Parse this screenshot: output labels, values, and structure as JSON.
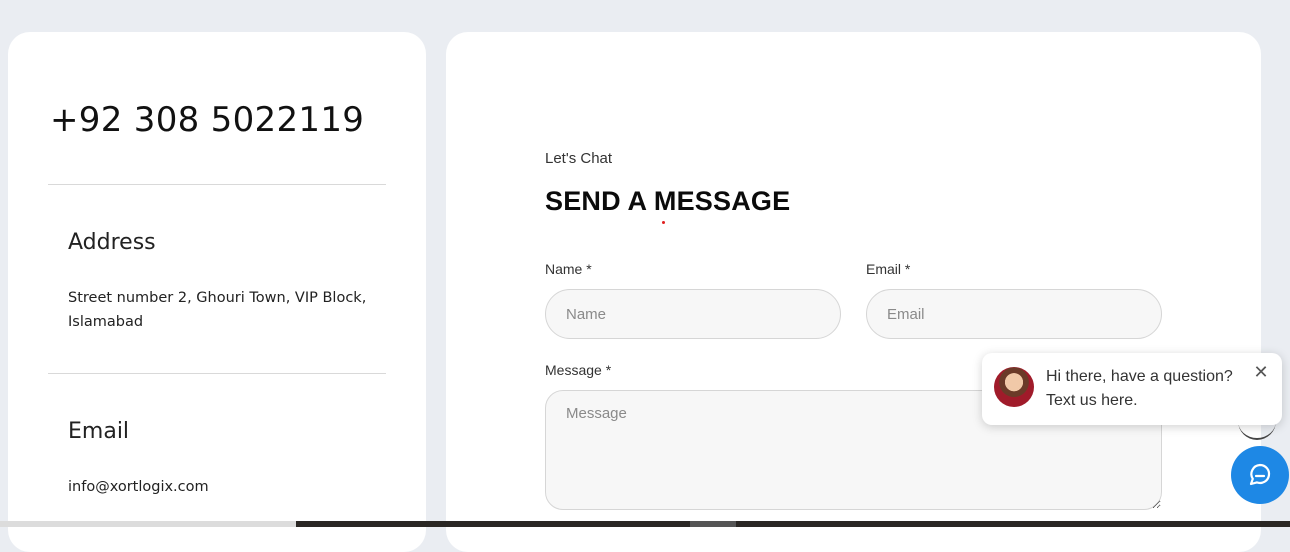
{
  "contact": {
    "phone": "+92 308 5022119",
    "address_title": "Address",
    "address_text": "Street number 2, Ghouri Town, VIP Block, Islamabad",
    "email_title": "Email",
    "email_text": "info@xortlogix.com"
  },
  "form": {
    "eyebrow": "Let's Chat",
    "heading": "SEND A MESSAGE",
    "name_label": "Name *",
    "name_placeholder": "Name",
    "email_label": "Email *",
    "email_placeholder": "Email",
    "message_label": "Message *",
    "message_placeholder": "Message"
  },
  "chat_widget": {
    "greeting": "Hi there, have a question? Text us here.",
    "close_icon": "close-icon",
    "button_icon": "chat-bubble-icon",
    "accent": "#1e88e5"
  }
}
